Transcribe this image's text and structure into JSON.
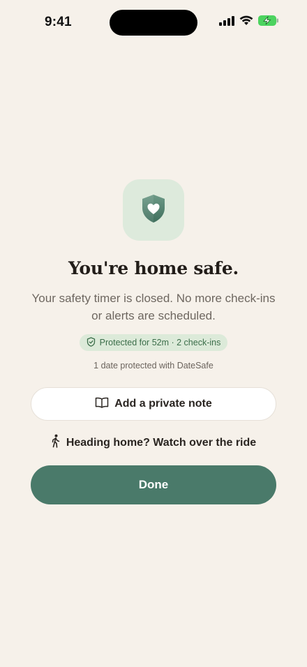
{
  "status_bar": {
    "time": "9:41"
  },
  "hero": {
    "icon": "shield-heart-icon",
    "title": "You're home safe.",
    "subtitle": "Your safety timer is closed. No more check-ins or alerts are scheduled.",
    "pill": "Protected for 52m · 2 check-ins",
    "stat": "1 date protected with DateSafe"
  },
  "actions": {
    "note_label": "Add a private note",
    "ride_label": "Heading home? Watch over the ride",
    "done_label": "Done"
  },
  "colors": {
    "background": "#f6f1ea",
    "accent": "#4a7a6a",
    "tile": "#ddeadc",
    "pill_text": "#3c6e4a"
  }
}
